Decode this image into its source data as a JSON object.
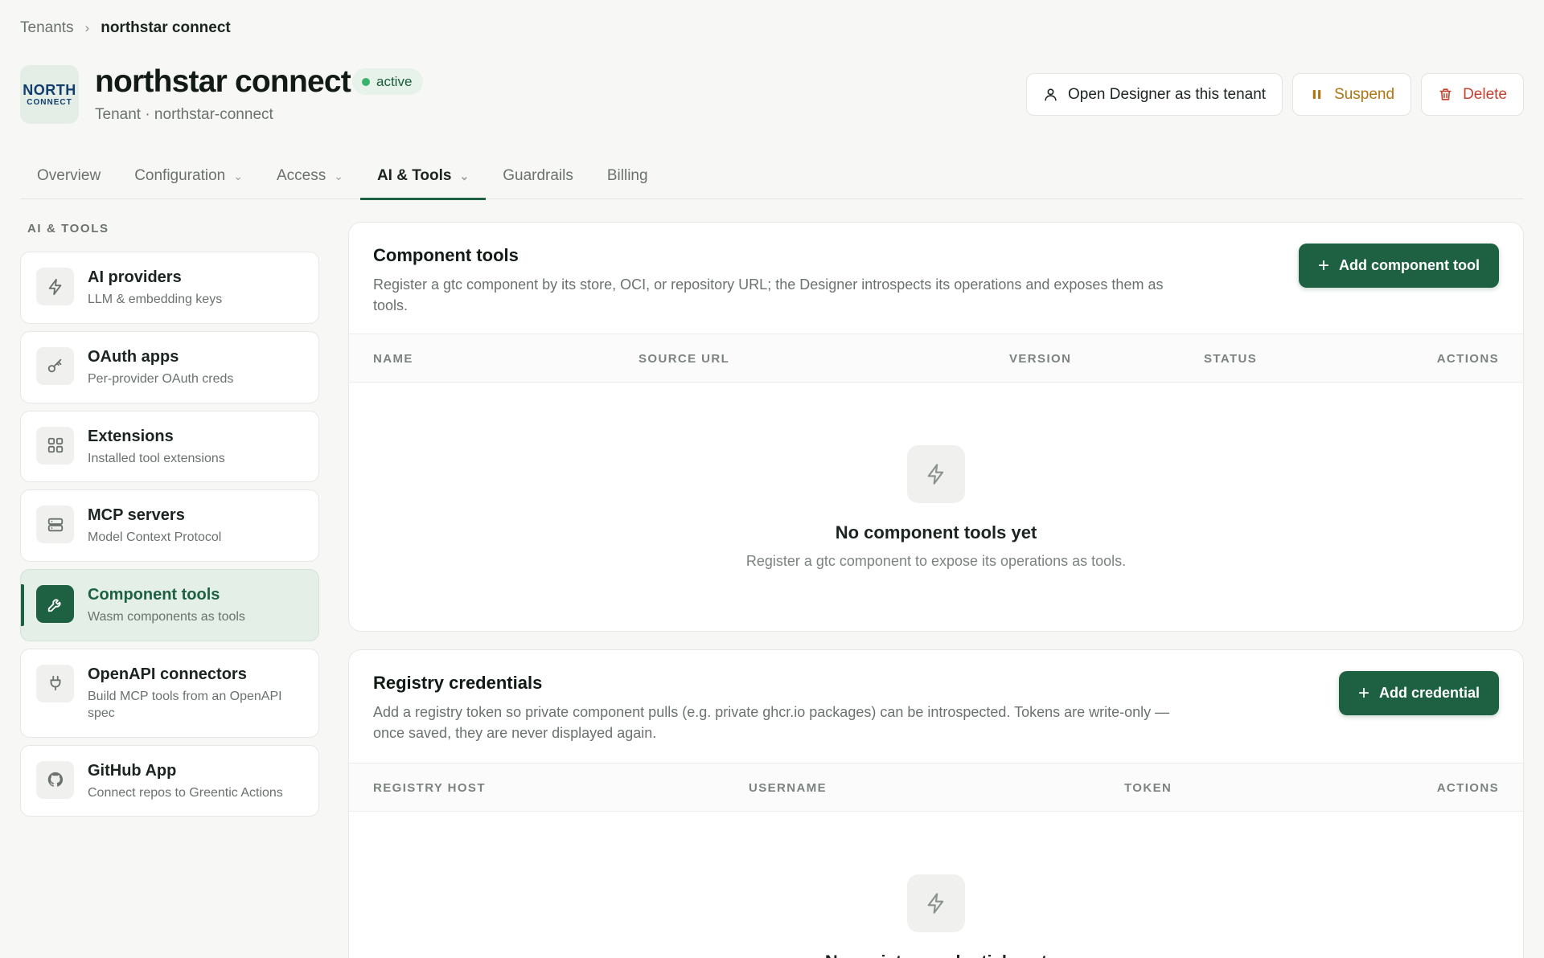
{
  "breadcrumb": {
    "parent": "Tenants",
    "separator": "›",
    "current": "northstar connect"
  },
  "tenant": {
    "logo_line1": "NORTH",
    "logo_line2": "CONNECT",
    "name": "northstar connect",
    "status": "active",
    "subtitle": "Tenant · northstar-connect"
  },
  "actions": {
    "open_designer": "Open Designer as this tenant",
    "suspend": "Suspend",
    "delete": "Delete"
  },
  "tabs": [
    {
      "label": "Overview"
    },
    {
      "label": "Configuration",
      "chevron": "⌄"
    },
    {
      "label": "Access",
      "chevron": "⌄"
    },
    {
      "label": "AI & Tools",
      "chevron": "⌄"
    },
    {
      "label": "Guardrails"
    },
    {
      "label": "Billing"
    }
  ],
  "sidebar": {
    "heading": "AI & TOOLS",
    "items": [
      {
        "title": "AI providers",
        "desc": "LLM & embedding keys",
        "icon": "lightning-icon"
      },
      {
        "title": "OAuth apps",
        "desc": "Per-provider OAuth creds",
        "icon": "key-icon"
      },
      {
        "title": "Extensions",
        "desc": "Installed tool extensions",
        "icon": "grid-icon"
      },
      {
        "title": "MCP servers",
        "desc": "Model Context Protocol",
        "icon": "server-icon"
      },
      {
        "title": "Component tools",
        "desc": "Wasm components as tools",
        "icon": "wrench-icon"
      },
      {
        "title": "OpenAPI connectors",
        "desc": "Build MCP tools from an OpenAPI spec",
        "icon": "plug-icon"
      },
      {
        "title": "GitHub App",
        "desc": "Connect repos to Greentic Actions",
        "icon": "github-icon"
      }
    ]
  },
  "component_tools": {
    "title": "Component tools",
    "description": "Register a gtc component by its store, OCI, or repository URL; the Designer introspects its operations and exposes them as tools.",
    "add_button": "Add component tool",
    "columns": {
      "name": "NAME",
      "source_url": "SOURCE URL",
      "version": "VERSION",
      "status": "STATUS",
      "actions": "ACTIONS"
    },
    "empty_title": "No component tools yet",
    "empty_desc": "Register a gtc component to expose its operations as tools."
  },
  "registry_credentials": {
    "title": "Registry credentials",
    "description": "Add a registry token so private component pulls (e.g. private ghcr.io packages) can be introspected. Tokens are write-only — once saved, they are never displayed again.",
    "add_button": "Add credential",
    "columns": {
      "registry_host": "REGISTRY HOST",
      "username": "USERNAME",
      "token": "TOKEN",
      "actions": "ACTIONS"
    },
    "empty_title": "No registry credentials yet"
  },
  "colors": {
    "primary": "#1d6142",
    "active_bg": "#e4efe7",
    "status_green": "#3bb26b",
    "warn": "#b27410",
    "danger": "#c2412f"
  }
}
